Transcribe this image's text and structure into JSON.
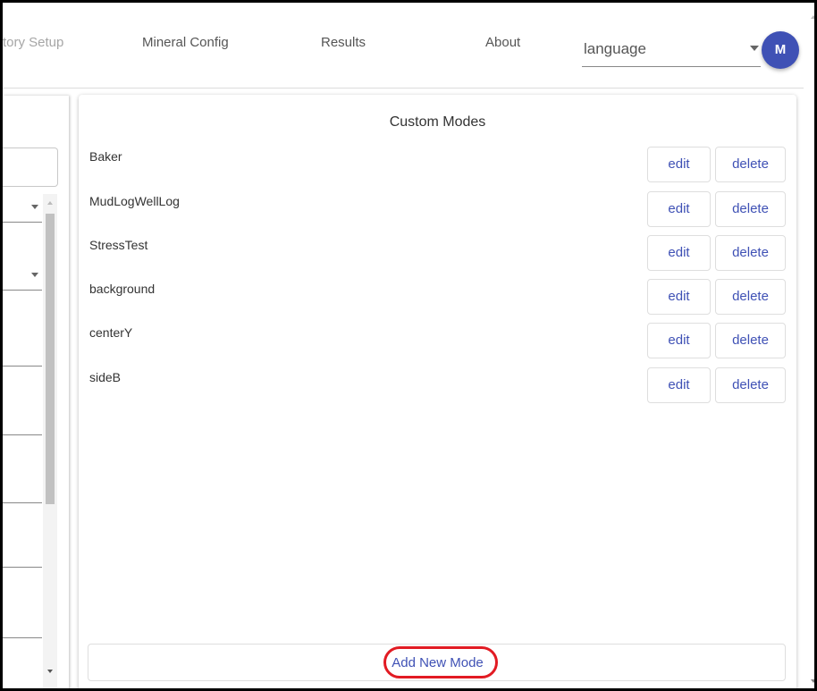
{
  "nav": {
    "items": [
      "tory Setup",
      "Mineral Config",
      "Results",
      "About"
    ],
    "language_placeholder": "language",
    "avatar_initial": "M"
  },
  "card": {
    "title": "Custom Modes",
    "modes": [
      "Baker",
      "MudLogWellLog",
      "StressTest",
      "background",
      "centerY",
      "sideB"
    ],
    "edit_label": "edit",
    "delete_label": "delete",
    "add_label": "Add New Mode"
  },
  "colors": {
    "accent": "#3f51b5",
    "highlight": "#e21b23"
  }
}
